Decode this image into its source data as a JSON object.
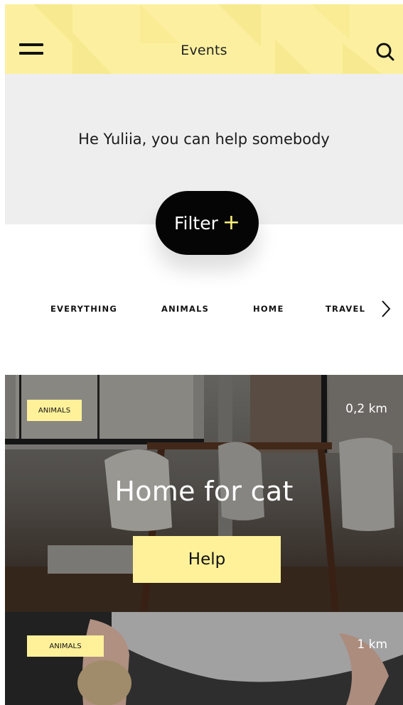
{
  "header": {
    "title": "Events",
    "menu_icon": "hamburger-menu-icon",
    "search_icon": "search-icon",
    "background": "#fcf0a0"
  },
  "hero": {
    "greeting": "He Yuliia, you can help somebody"
  },
  "filter": {
    "label": "Filter",
    "plus": "+",
    "accent": "#fff37a"
  },
  "categories": {
    "items": [
      "EVERYTHING",
      "ANIMALS",
      "HOME",
      "TRAVEL"
    ],
    "next_icon": "chevron-right-icon"
  },
  "events": [
    {
      "tag": "ANIMALS",
      "distance": "0,2 km",
      "title": "Home for cat",
      "action": "Help"
    },
    {
      "tag": "ANIMALS",
      "distance": "1 km"
    }
  ],
  "colors": {
    "accent_yellow": "#fff19a",
    "dark": "#050505"
  }
}
